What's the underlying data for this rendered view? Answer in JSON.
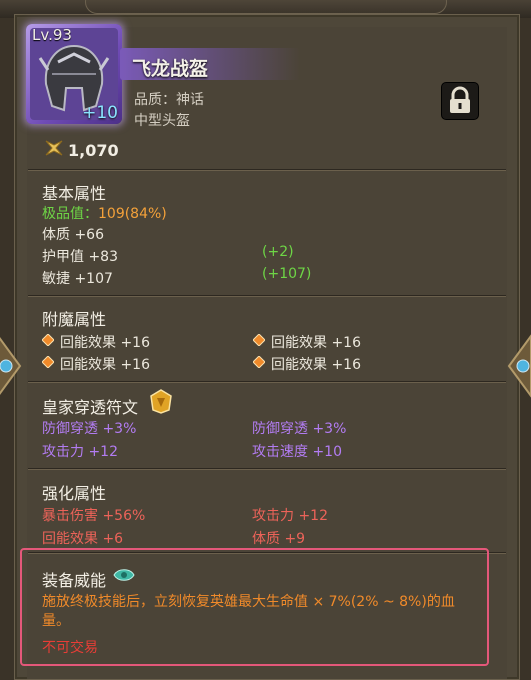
{
  "item": {
    "level": "Lv.93",
    "enhance": "+10",
    "name": "飞龙战盔",
    "quality": "品质：神话",
    "slot": "中型头盔",
    "price": "1,070"
  },
  "basic": {
    "title": "基本属性",
    "rating_label": "极品值：",
    "rating_value": "109(84%)",
    "stats": [
      {
        "label": "体质 +66",
        "bonus": ""
      },
      {
        "label": "护甲值 +83",
        "bonus": "(+2)"
      },
      {
        "label": "敏捷 +107",
        "bonus": "(+107)"
      }
    ]
  },
  "enchant": {
    "title": "附魔属性",
    "items": [
      "回能效果 +16",
      "回能效果 +16",
      "回能效果 +16",
      "回能效果 +16"
    ]
  },
  "rune": {
    "title": "皇家穿透符文",
    "items": [
      "防御穿透 +3%",
      "防御穿透 +3%",
      "攻击力 +12",
      "攻击速度 +10"
    ]
  },
  "enhance_attr": {
    "title": "强化属性",
    "items": [
      "暴击伤害 +56%",
      "攻击力 +12",
      "回能效果 +6",
      "体质 +9"
    ]
  },
  "skill": {
    "title": "装备威能",
    "description": "施放终极技能后，立刻恢复英雄最大生命值 × 7%(2% ~ 8%)的血量。",
    "untradable": "不可交易"
  },
  "colors": {
    "green": "#6ed646",
    "orange": "#f3a13a",
    "purple": "#b27cf2",
    "red": "#ec6359",
    "highlight": "#e4587a"
  }
}
